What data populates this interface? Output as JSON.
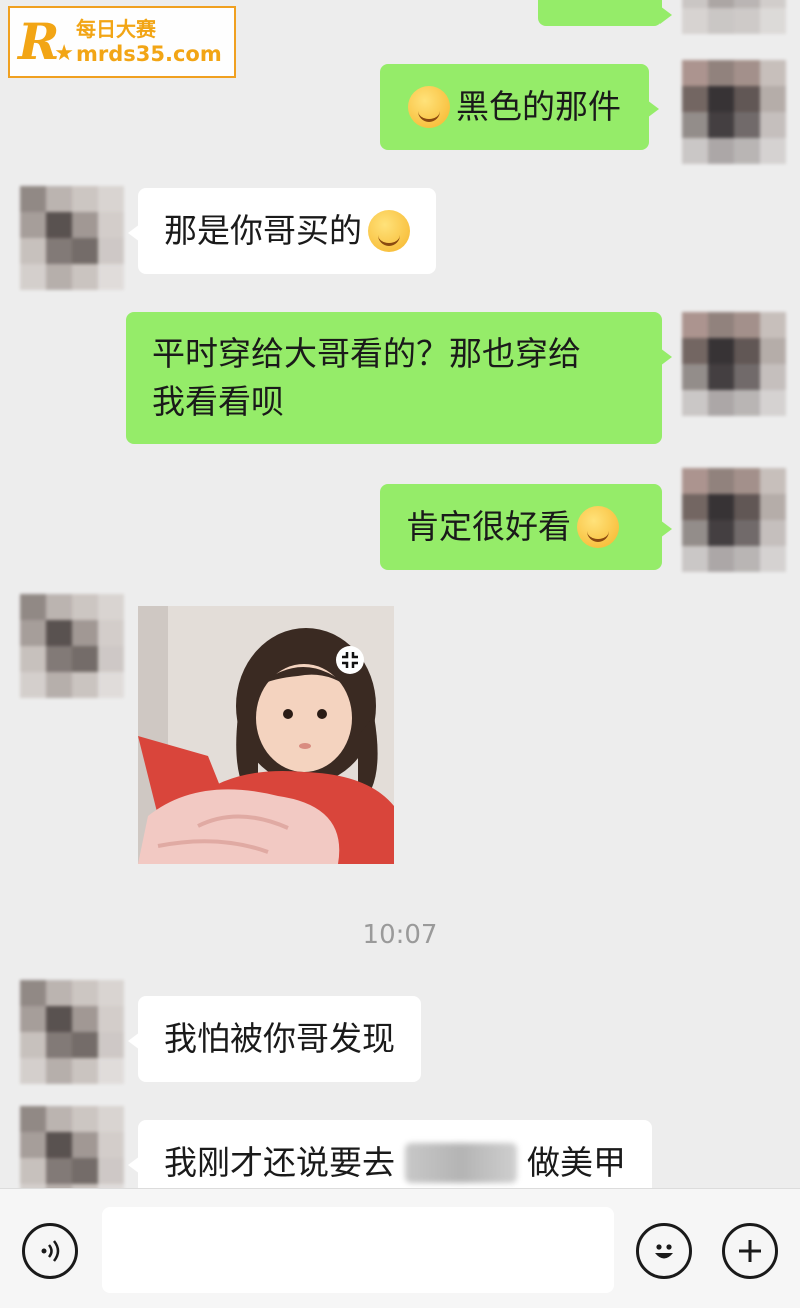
{
  "watermark": {
    "logo_letter": "R",
    "brand": "每日大赛",
    "url": "mrds35.com"
  },
  "messages": [
    {
      "id": "m1",
      "side": "out",
      "text": "黑色的那件",
      "emoji_before": "dizzy-face-emoji"
    },
    {
      "id": "m2",
      "side": "in",
      "text": "那是你哥买的",
      "emoji_after": "sweat-smile-emoji"
    },
    {
      "id": "m3",
      "side": "out",
      "text_line1": "平时穿给大哥看的？那也穿给",
      "text_line2": "我看看呗"
    },
    {
      "id": "m4",
      "side": "out",
      "text": "肯定很好看",
      "emoji_after": "grinning-emoji"
    },
    {
      "id": "m5",
      "side": "in",
      "type": "image",
      "image": "girl-sticker-photo"
    },
    {
      "id": "m6",
      "side": "in",
      "text": "我怕被你哥发现"
    },
    {
      "id": "m7",
      "side": "in",
      "text_before": "我刚才还说要去",
      "text_after": "做美甲"
    }
  ],
  "timestamp": "10:07",
  "input_bar": {
    "voice_icon": "voice-icon",
    "emoji_icon": "emoji-icon",
    "plus_icon": "plus-icon",
    "placeholder": ""
  },
  "colors": {
    "outgoing_bubble": "#95ec69",
    "incoming_bubble": "#ffffff",
    "background": "#ededed"
  }
}
